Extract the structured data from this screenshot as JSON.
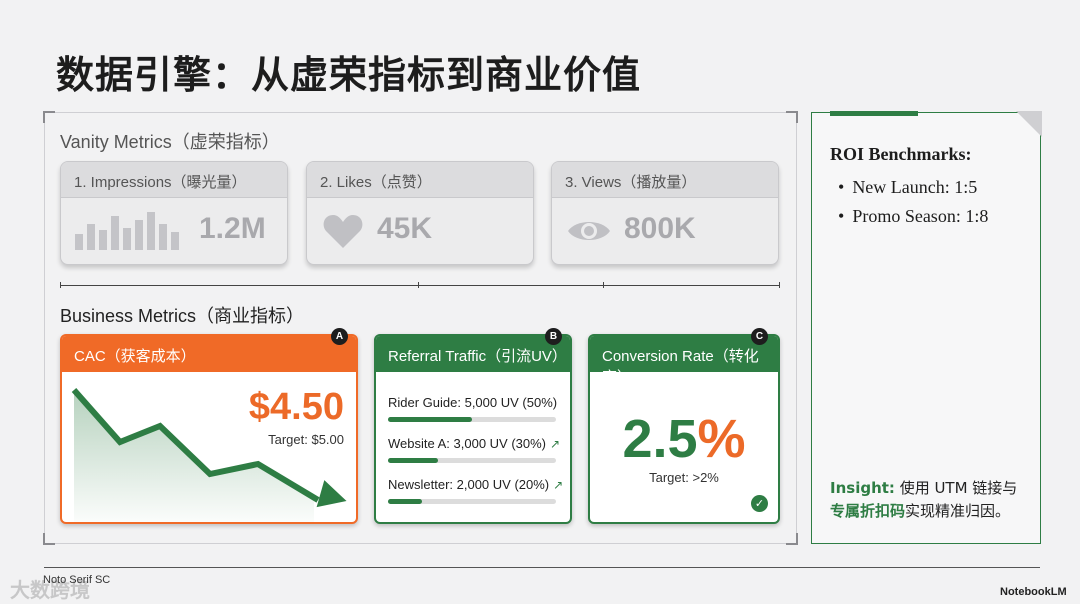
{
  "title": "数据引擎：从虚荣指标到商业价值",
  "vanity": {
    "label": "Vanity Metrics（虚荣指标）",
    "cards": [
      {
        "label": "1. Impressions（曝光量）",
        "value": "1.2M",
        "icon": "bar-chart-icon"
      },
      {
        "label": "2. Likes（点赞）",
        "value": "45K",
        "icon": "heart-icon"
      },
      {
        "label": "3. Views（播放量）",
        "value": "800K",
        "icon": "eye-icon"
      }
    ]
  },
  "business": {
    "label": "Business Metrics（商业指标）",
    "cac": {
      "marker": "A",
      "label": "CAC（获客成本）",
      "value": "$4.50",
      "target": "Target: $5.00",
      "trend": "down"
    },
    "referral": {
      "marker": "B",
      "label": "Referral Traffic（引流UV）",
      "rows": [
        {
          "text": "Rider Guide: 5,000 UV (50%)",
          "share": 0.5,
          "arrow": ""
        },
        {
          "text": "Website A: 3,000 UV (30%)",
          "share": 0.3,
          "arrow": "↗"
        },
        {
          "text": "Newsletter: 2,000 UV (20%)",
          "share": 0.2,
          "arrow": "↗"
        }
      ]
    },
    "conversion": {
      "marker": "C",
      "label": "Conversion Rate（转化率）",
      "value_num": "2.5",
      "value_unit": "%",
      "target": "Target: >2%"
    }
  },
  "roi": {
    "title": "ROI Benchmarks:",
    "items": [
      "New Launch: 1:5",
      "Promo Season: 1:8"
    ],
    "insight_label": "Insight:",
    "insight_text_1": " 使用 UTM 链接与",
    "insight_highlight": "专属折扣码",
    "insight_text_2": "实现精准归因。"
  },
  "footer": {
    "font_note": "Noto Serif SC",
    "brand": "NotebookLM",
    "watermark": "大数跨境"
  },
  "colors": {
    "accent_orange": "#f06a27",
    "accent_green": "#2e7d44",
    "muted_gray": "#a9a9ad"
  }
}
